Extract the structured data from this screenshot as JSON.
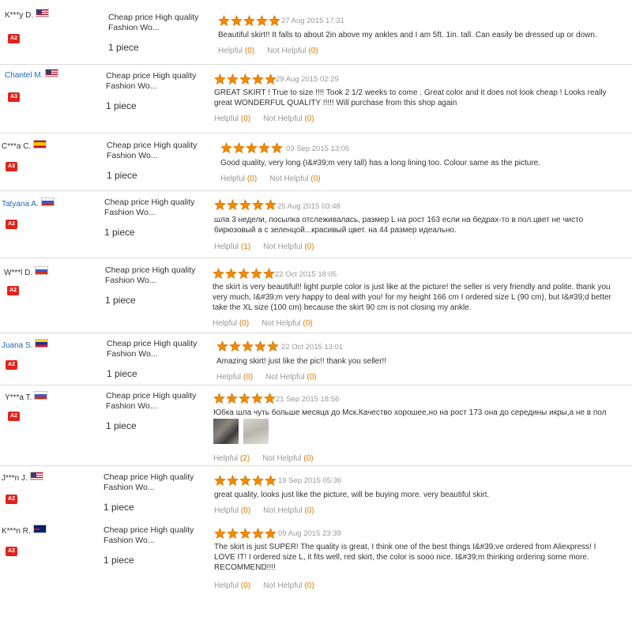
{
  "reviews": [
    {
      "user": "K***y D.",
      "flag": "us",
      "level": "A2",
      "product": "Cheap price High quality Fashion Wo...",
      "quantity": "1 piece",
      "date": "27 Aug 2015 17:31",
      "text": "Beautiful skirt!! It falls to about 2in above my ankles and I am 5ft. 1in. tall. Can easily be dressed up or down.",
      "helpful_label": "Helpful",
      "helpful": "(0)",
      "not_helpful_label": "Not Helpful",
      "not_helpful": "(0)"
    },
    {
      "user": "Chantel M.",
      "flag": "us",
      "level": "A3",
      "product": "Cheap price High quality Fashion Wo...",
      "quantity": "1 piece",
      "date": "29 Aug 2015 02:29",
      "text": "GREAT SKIRT ! True to size !!!! Took 2 1/2 weeks to come . Great color and it does not look cheap ! Looks really great WONDERFUL QUALITY !!!!! Will purchase from this shop again",
      "helpful_label": "Helpful",
      "helpful": "(0)",
      "not_helpful_label": "Not Helpful",
      "not_helpful": "(0)"
    },
    {
      "user": "C***a C.",
      "flag": "es",
      "level": "A3",
      "product": "Cheap price High quality Fashion Wo...",
      "quantity": "1 piece",
      "date": "03 Sep 2015 13:05",
      "text": "Good quality, very long (I&#39;m very tall) has a long lining too. Colour same as the picture.",
      "helpful_label": "Helpful",
      "helpful": "(0)",
      "not_helpful_label": "Not Helpful",
      "not_helpful": "(0)"
    },
    {
      "user": "Tatyana A.",
      "flag": "ru",
      "level": "A2",
      "product": "Cheap price High quality Fashion Wo...",
      "quantity": "1 piece",
      "date": "25 Aug 2015 03:48",
      "text": "шла 3 недели, посылка отслеживалась, размер L на рост 163 если на бедрах-то в пол.цвет не чисто бирюзовый а с зеленцой...красивый цвет. на 44 размер идеально.",
      "helpful_label": "Helpful",
      "helpful": "(1)",
      "not_helpful_label": "Not Helpful",
      "not_helpful": "(0)"
    },
    {
      "user": "W***l D.",
      "flag": "ru",
      "level": "A2",
      "product": "Cheap price High quality Fashion Wo...",
      "quantity": "1 piece",
      "date": "22 Oct 2015 18:05",
      "text": "the skirt is very beautiful!! light purple color is just like at the picture! the seller is very friendly and polite. thank you very much, I&#39;m very happy to deal with you! for my height 166 cm I ordered size L (90 cm), but I&#39;d better take the XL size (100 cm) because the skirt 90 cm is not closing my ankle.",
      "helpful_label": "Helpful",
      "helpful": "(0)",
      "not_helpful_label": "Not Helpful",
      "not_helpful": "(0)"
    },
    {
      "user": "Juana S.",
      "flag": "ve",
      "level": "A2",
      "product": "Cheap price High quality Fashion Wo...",
      "quantity": "1 piece",
      "date": "22 Oct 2015 13:01",
      "text": "Amazing skirt! just like the pic!! thank you seller!!",
      "helpful_label": "Helpful",
      "helpful": "(0)",
      "not_helpful_label": "Not Helpful",
      "not_helpful": "(0)"
    },
    {
      "user": "Y***a T.",
      "flag": "ru",
      "level": "A2",
      "product": "Cheap price High quality Fashion Wo...",
      "quantity": "1 piece",
      "date": "21 Sep 2015 18:56",
      "text": "Юбка шла чуть больше месяца до Мск.Качество хорошее,но на рост 173 она до середины икры,а не в пол",
      "helpful_label": "Helpful",
      "helpful": "(2)",
      "not_helpful_label": "Not Helpful",
      "not_helpful": "(0)"
    },
    {
      "user": "J***n J.",
      "flag": "us",
      "level": "A2",
      "product": "Cheap price High quality Fashion Wo...",
      "quantity": "1 piece",
      "date": "19 Sep 2015 05:36",
      "text": "great quality, looks just like the picture, will be buying more. very beautiful skirt.",
      "helpful_label": "Helpful",
      "helpful": "(0)",
      "not_helpful_label": "Not Helpful",
      "not_helpful": "(0)"
    },
    {
      "user": "K***n R.",
      "flag": "nz",
      "level": "A2",
      "product": "Cheap price High quality Fashion Wo...",
      "quantity": "1 piece",
      "date": "09 Aug 2015 23:39",
      "text": "The skirt is just SUPER! The quality is great, I think one of the best things I&#39;ve ordered from Aliexpress! I LOVE IT! I ordered size L, it fits well, red skirt, the color is sooo nice. I&#39;m thinking ordering some more. RECOMMEND!!!!",
      "helpful_label": "Helpful",
      "helpful": "(0)",
      "not_helpful_label": "Not Helpful",
      "not_helpful": "(0)"
    }
  ],
  "stars": 5,
  "colors": {
    "star": "#f28a00",
    "badge": "#e0231c",
    "link": "#1d69b6",
    "count": "#e07b00"
  }
}
